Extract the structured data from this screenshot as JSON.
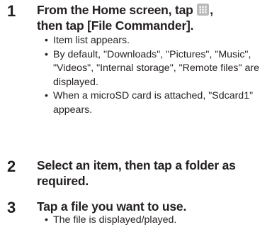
{
  "steps": [
    {
      "number": "1",
      "title_before_icon": "From the Home screen, tap ",
      "title_icon": "apps-grid-icon",
      "title_after_icon": ",",
      "title_line2": "then tap [File Commander].",
      "bullets": [
        "Item list appears.",
        "By default, \"Downloads\", \"Pictures\", \"Music\", \"Videos\", \"Internal storage\", \"Remote files\" are displayed.",
        "When a microSD card is attached, \"Sdcard1\" appears."
      ]
    },
    {
      "number": "2",
      "title": "Select an item, then tap a folder as required.",
      "bullets": []
    },
    {
      "number": "3",
      "title": "Tap a file you want to use.",
      "bullets": [
        "The file is displayed/played."
      ]
    }
  ],
  "bullet_char": "•",
  "colors": {
    "text": "#231f20",
    "icon_bg": "#b9b9b9",
    "icon_dots": "#ffffff"
  }
}
